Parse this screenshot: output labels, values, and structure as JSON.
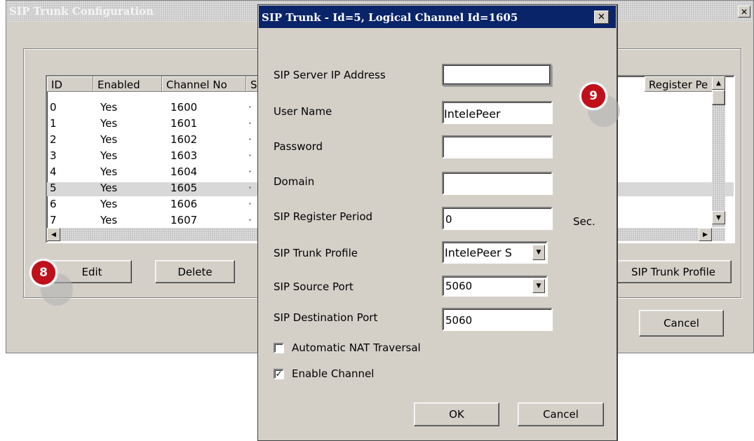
{
  "back_window": {
    "title": "SIP Trunk Configuration",
    "close_glyph": "✕",
    "columns": [
      "ID",
      "Enabled",
      "Channel No",
      "S",
      "Register Pe"
    ],
    "rows": [
      {
        "id": "0",
        "enabled": "Yes",
        "channel": "1600"
      },
      {
        "id": "1",
        "enabled": "Yes",
        "channel": "1601"
      },
      {
        "id": "2",
        "enabled": "Yes",
        "channel": "1602"
      },
      {
        "id": "3",
        "enabled": "Yes",
        "channel": "1603"
      },
      {
        "id": "4",
        "enabled": "Yes",
        "channel": "1604"
      },
      {
        "id": "5",
        "enabled": "Yes",
        "channel": "1605"
      },
      {
        "id": "6",
        "enabled": "Yes",
        "channel": "1606"
      },
      {
        "id": "7",
        "enabled": "Yes",
        "channel": "1607"
      }
    ],
    "selected_row": "5",
    "buttons": {
      "edit": "Edit",
      "delete": "Delete",
      "sip_trunk_profile": "SIP Trunk Profile",
      "cancel": "Cancel"
    }
  },
  "dialog": {
    "title": "SIP Trunk - Id=5, Logical Channel Id=1605",
    "close_glyph": "✕",
    "fields": {
      "server_ip": {
        "label": "SIP Server IP Address",
        "value": ""
      },
      "user_name": {
        "label": "User Name",
        "value": "IntelePeer"
      },
      "password": {
        "label": "Password",
        "value": ""
      },
      "domain": {
        "label": "Domain",
        "value": ""
      },
      "register_period": {
        "label": "SIP Register Period",
        "value": "0",
        "unit": "Sec."
      },
      "trunk_profile": {
        "label": "SIP Trunk Profile",
        "value": "IntelePeer S"
      },
      "source_port": {
        "label": "SIP Source Port",
        "value": "5060"
      },
      "destination_port": {
        "label": "SIP Destination Port",
        "value": "5060"
      }
    },
    "checkboxes": {
      "nat": {
        "label": "Automatic NAT Traversal",
        "checked": false
      },
      "enable_channel": {
        "label": "Enable Channel",
        "checked": true
      }
    },
    "buttons": {
      "ok": "OK",
      "cancel": "Cancel"
    }
  },
  "callouts": {
    "edit_step": "8",
    "profile_step": "9"
  },
  "colors": {
    "title_active": "#0a246a",
    "title_inactive": "#8a8a8a",
    "badge": "#c0101a",
    "window_face": "#d4d0c8"
  }
}
